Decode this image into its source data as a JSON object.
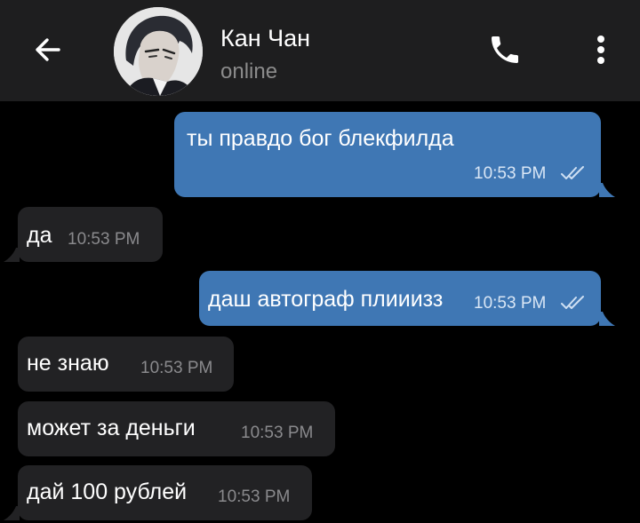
{
  "header": {
    "contact_name": "Кан Чан",
    "status": "online",
    "icons": {
      "back": "back-arrow-icon",
      "call": "phone-icon",
      "menu": "more-vertical-icon"
    }
  },
  "colors": {
    "header_bg": "#1e1e1f",
    "chat_bg": "#000000",
    "outgoing_bubble": "#3f77b4",
    "incoming_bubble": "#222224",
    "read_ticks": "#cfe0f3"
  },
  "messages": [
    {
      "direction": "out",
      "text": "ты правдо бог блекфилда",
      "time": "10:53 PM",
      "read": true
    },
    {
      "direction": "in",
      "text": "да",
      "time": "10:53 PM"
    },
    {
      "direction": "out",
      "text": "даш автограф плииизз",
      "time": "10:53 PM",
      "read": true
    },
    {
      "direction": "in",
      "text": "не знаю",
      "time": "10:53 PM"
    },
    {
      "direction": "in",
      "text": "может за деньги",
      "time": "10:53 PM"
    },
    {
      "direction": "in",
      "text": "дай 100 рублей",
      "time": "10:53 PM"
    }
  ]
}
